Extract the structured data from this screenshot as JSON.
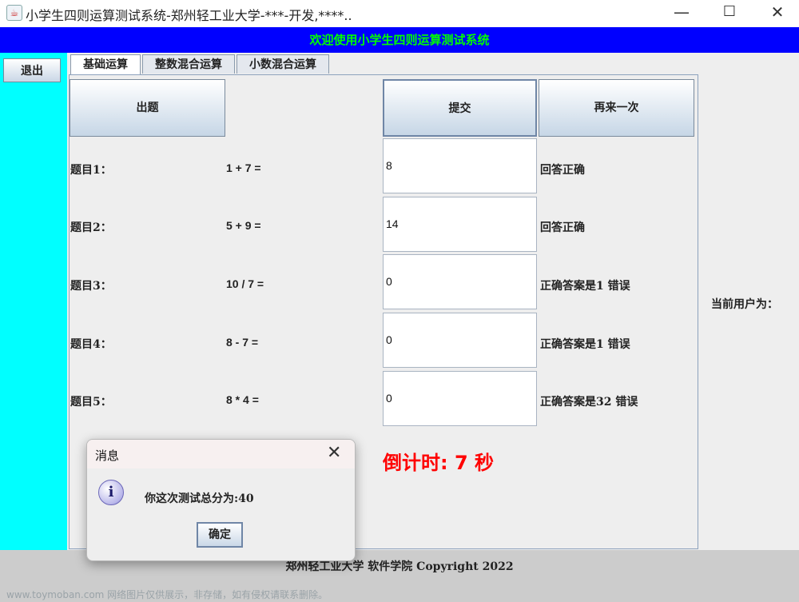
{
  "window": {
    "title": "小学生四则运算测试系统-郑州轻工业大学-***-开发,****..",
    "minimize_glyph": "—",
    "maximize_glyph": "☐",
    "close_glyph": "✕",
    "app_icon": "java-cup-icon"
  },
  "banner": {
    "text": "欢迎使用小学生四则运算测试系统",
    "text_color": "#00ff00",
    "bg_color": "#0000ff"
  },
  "sidebar": {
    "exit_label": "退出",
    "bg_color": "#00ffff"
  },
  "tabs": [
    {
      "label": "基础运算",
      "active": true
    },
    {
      "label": "整数混合运算",
      "active": false
    },
    {
      "label": "小数混合运算",
      "active": false
    }
  ],
  "buttons": {
    "generate": "出题",
    "submit": "提交",
    "retry": "再来一次"
  },
  "questions": [
    {
      "label": "题目1：",
      "expr": "1 + 7 =",
      "answer": "8",
      "result": "回答正确"
    },
    {
      "label": "题目2：",
      "expr": "5 + 9 =",
      "answer": "14",
      "result": "回答正确"
    },
    {
      "label": "题目3：",
      "expr": "10 / 7 =",
      "answer": "0",
      "result": "正确答案是1  错误"
    },
    {
      "label": "题目4：",
      "expr": "8 - 7 =",
      "answer": "0",
      "result": "正确答案是1  错误"
    },
    {
      "label": "题目5：",
      "expr": "8 * 4 =",
      "answer": "0",
      "result": "正确答案是32  错误"
    }
  ],
  "countdown": {
    "text": "倒计时:  7 秒",
    "color": "#ff0000"
  },
  "user": {
    "label": "当前用户为："
  },
  "footer": {
    "text": "郑州轻工业大学   软件学院  Copyright 2022"
  },
  "watermark": {
    "text": "www.toymoban.com 网络图片仅供展示，非存储，如有侵权请联系删除。"
  },
  "dialog": {
    "title": "消息",
    "close_glyph": "✕",
    "icon": "info-icon",
    "icon_glyph": "i",
    "message": "你这次测试总分为:40",
    "ok_label": "确定"
  }
}
